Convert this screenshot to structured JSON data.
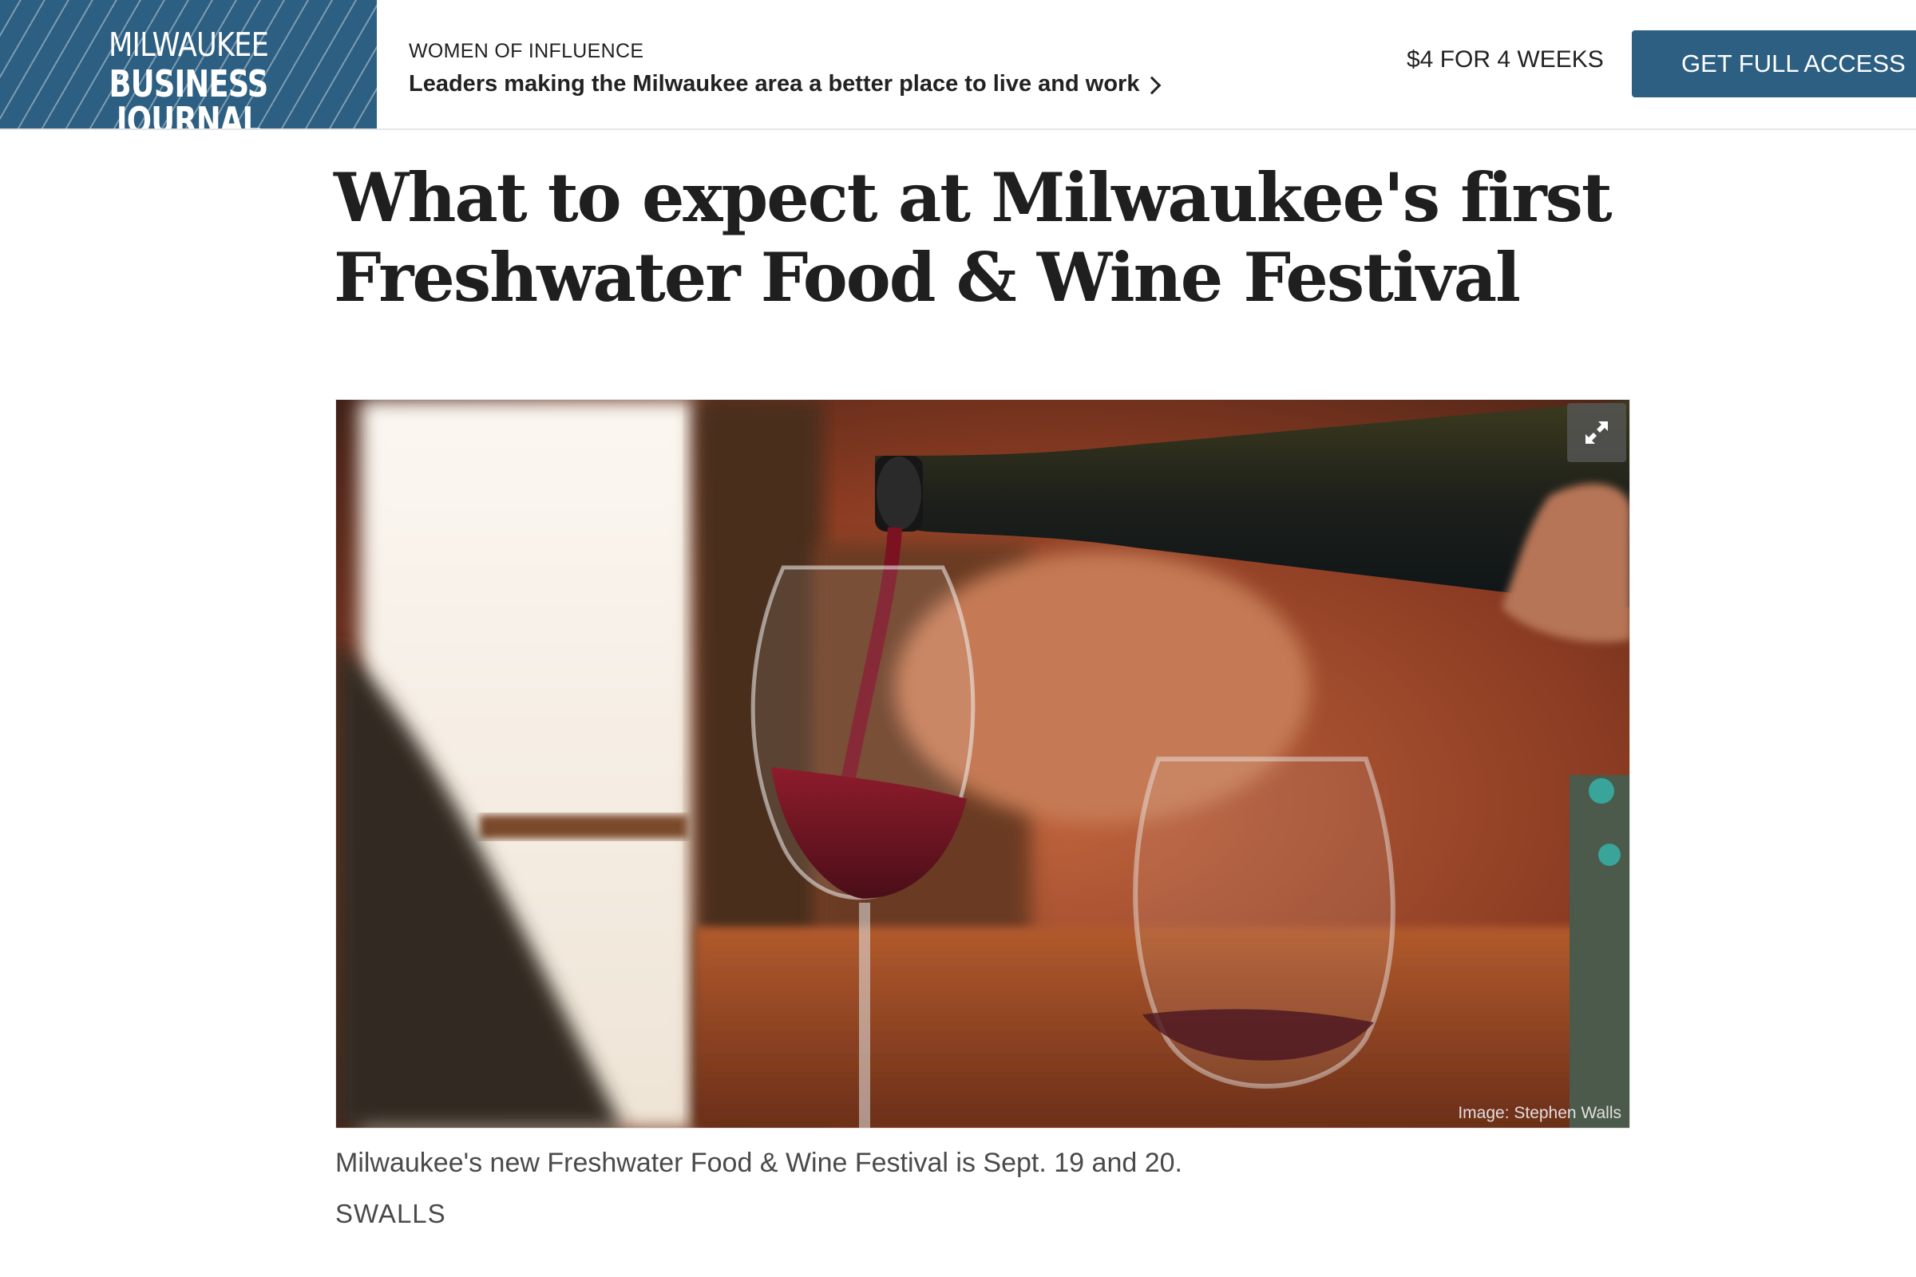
{
  "header": {
    "logo_line1": "MILWAUKEE",
    "logo_line2": "BUSINESS JOURNAL",
    "promo_kicker": "WOMEN OF INFLUENCE",
    "promo_link": "Leaders making the Milwaukee area a better place to live and work",
    "price_offer": "$4 FOR 4 WEEKS",
    "cta_label": "GET FULL ACCESS"
  },
  "article": {
    "headline": "What to expect at Milwaukee's first Freshwater Food & Wine Festival",
    "image_credit": "Image: Stephen Walls",
    "caption": "Milwaukee's new Freshwater Food & Wine Festival is Sept. 19 and 20.",
    "byline": "SWALLS"
  },
  "colors": {
    "brand_blue": "#2c5f82",
    "text_dark": "#1f1f1f",
    "text_muted": "#4a4a4a"
  },
  "icons": {
    "promo_arrow": "chevron-right-icon",
    "image_expand": "expand-icon"
  }
}
